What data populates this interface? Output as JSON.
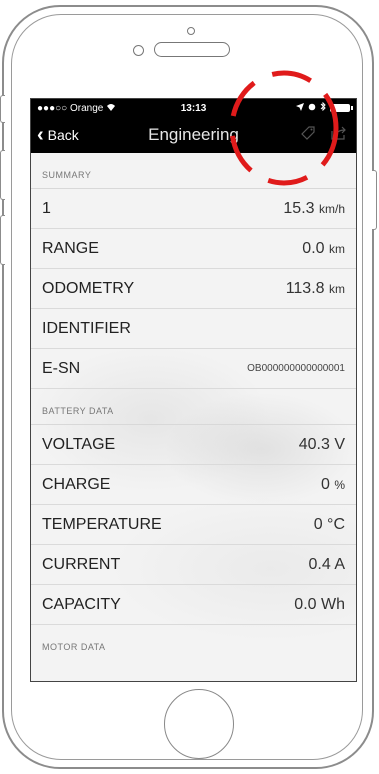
{
  "status_bar": {
    "carrier": "●●●○○ Orange",
    "time": "13:13"
  },
  "nav": {
    "back_label": "Back",
    "title": "Engineering"
  },
  "summary": {
    "header": "SUMMARY",
    "rows": [
      {
        "label": "1",
        "value": "15.3",
        "unit": "km/h"
      },
      {
        "label": "RANGE",
        "value": "0.0",
        "unit": "km"
      },
      {
        "label": "ODOMETRY",
        "value": "113.8",
        "unit": "km"
      },
      {
        "label": "IDENTIFIER",
        "value": "",
        "unit": ""
      },
      {
        "label": "E-SN",
        "value": "OB000000000000001",
        "unit": ""
      }
    ]
  },
  "battery": {
    "header": "BATTERY DATA",
    "rows": [
      {
        "label": "VOLTAGE",
        "value": "40.3",
        "unit": "V"
      },
      {
        "label": "CHARGE",
        "value": "0",
        "unit": "%"
      },
      {
        "label": "TEMPERATURE",
        "value": "0",
        "unit": "°C"
      },
      {
        "label": "CURRENT",
        "value": "0.4",
        "unit": "A"
      },
      {
        "label": "CAPACITY",
        "value": "0.0",
        "unit": "Wh"
      }
    ]
  },
  "motor": {
    "header": "MOTOR DATA"
  },
  "colors": {
    "nav_bg": "#000000",
    "annotation_red": "#e01b1b"
  },
  "icons": [
    "back-chevron-icon",
    "tag-icon",
    "share-icon",
    "location-arrow-icon",
    "bluetooth-icon",
    "battery-icon",
    "wifi-icon"
  ]
}
